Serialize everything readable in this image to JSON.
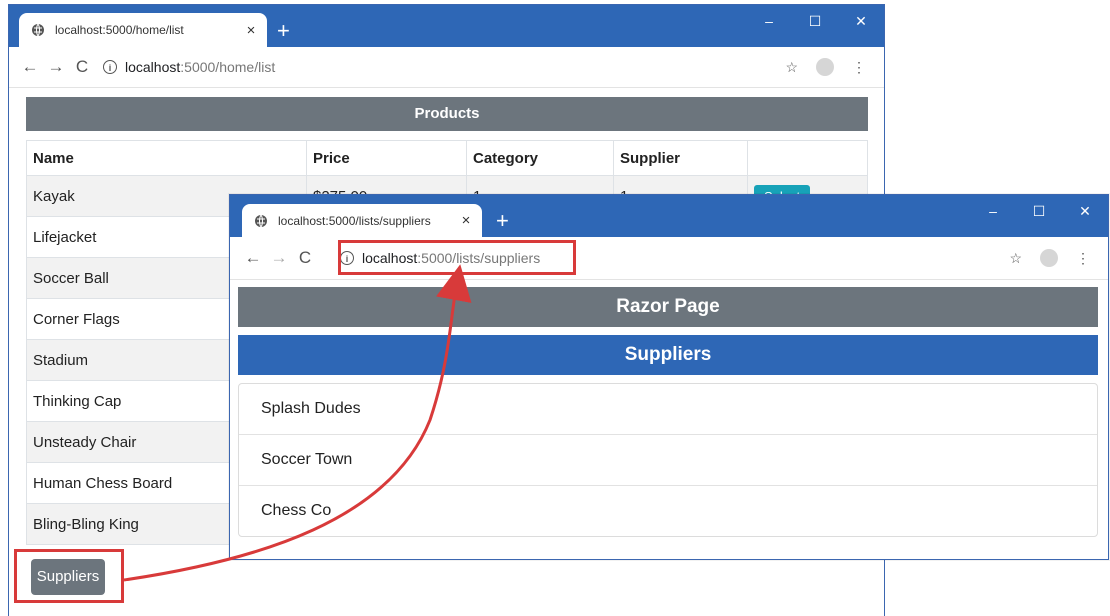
{
  "window_back": {
    "tab_title": "localhost:5000/home/list",
    "url_host": "localhost",
    "url_path": ":5000/home/list",
    "table_header": "Products",
    "columns": [
      "Name",
      "Price",
      "Category",
      "Supplier",
      ""
    ],
    "rows": [
      {
        "name": "Kayak",
        "price": "$275.00",
        "category": "1",
        "supplier": "1",
        "action": "Select"
      },
      {
        "name": "Lifejacket"
      },
      {
        "name": "Soccer Ball"
      },
      {
        "name": "Corner Flags"
      },
      {
        "name": "Stadium"
      },
      {
        "name": "Thinking Cap"
      },
      {
        "name": "Unsteady Chair"
      },
      {
        "name": "Human Chess Board"
      },
      {
        "name": "Bling-Bling King"
      }
    ],
    "button_label": "Suppliers"
  },
  "window_front": {
    "tab_title": "localhost:5000/lists/suppliers",
    "url_host": "localhost",
    "url_path": ":5000/lists/suppliers",
    "header_razor": "Razor Page",
    "header_suppliers": "Suppliers",
    "suppliers": [
      "Splash Dudes",
      "Soccer Town",
      "Chess Co"
    ]
  },
  "browser_controls": {
    "close_tab": "×",
    "new_tab": "+",
    "minimize": "–",
    "maximize": "☐",
    "close_window": "✕",
    "back": "←",
    "forward": "→",
    "reload": "C",
    "bookmark": "☆",
    "menu": "⋮"
  },
  "colors": {
    "titlebar": "#2e67b6",
    "header_gray": "#6c757d",
    "header_blue": "#2e67b6",
    "select_button": "#17a2b8",
    "annotation": "#d83a3a"
  }
}
